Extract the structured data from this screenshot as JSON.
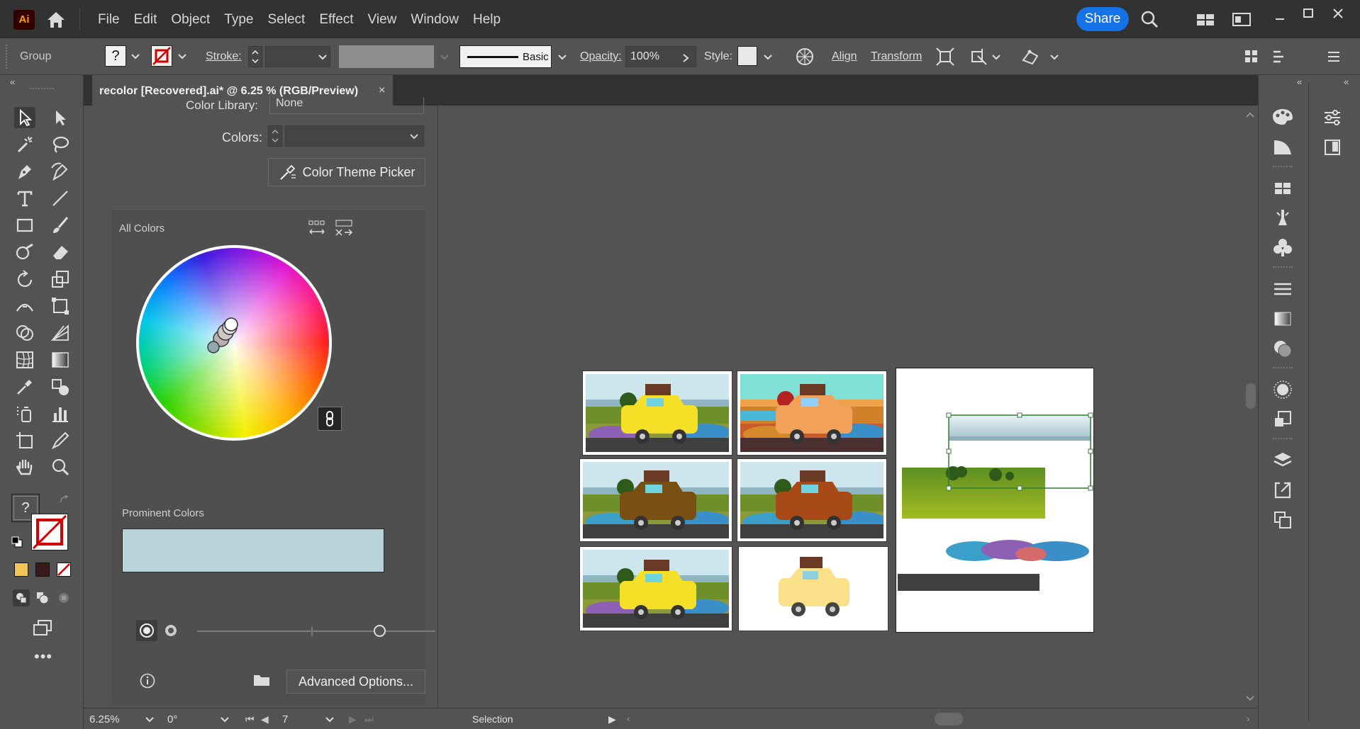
{
  "app": {
    "logo_text": "Ai"
  },
  "menu": [
    "File",
    "Edit",
    "Object",
    "Type",
    "Select",
    "Effect",
    "View",
    "Window",
    "Help"
  ],
  "share_label": "Share",
  "control_bar": {
    "selection_type": "Group",
    "fill_value": "?",
    "stroke_label": "Stroke:",
    "brush_label": "Basic",
    "opacity_label": "Opacity:",
    "opacity_value": "100%",
    "style_label": "Style:",
    "align_label": "Align",
    "transform_label": "Transform"
  },
  "document_tab": {
    "title": "recolor [Recovered].ai* @ 6.25 % (RGB/Preview)",
    "close": "×"
  },
  "recolor_panel": {
    "color_library_label": "Color Library:",
    "color_library_value": "None",
    "colors_label": "Colors:",
    "theme_picker_label": "Color Theme Picker",
    "all_colors_label": "All Colors",
    "prominent_colors_label": "Prominent Colors",
    "advanced_options_label": "Advanced Options..."
  },
  "toolbar_fill": {
    "value": "?"
  },
  "status_bar": {
    "zoom": "6.25%",
    "rotation": "0°",
    "artboard_number": "7",
    "mode": "Selection"
  },
  "colors": {
    "accent": "#1473e6",
    "panel_bg": "#535353",
    "menubar_bg": "#323232",
    "prominent_swatch": "#b9d3da",
    "car_yellow": "#f5e027",
    "car_orange": "#f2a15a",
    "car_brown": "#7a4f14",
    "car_rust": "#a84a17",
    "selection_green": "#2f7d32"
  }
}
